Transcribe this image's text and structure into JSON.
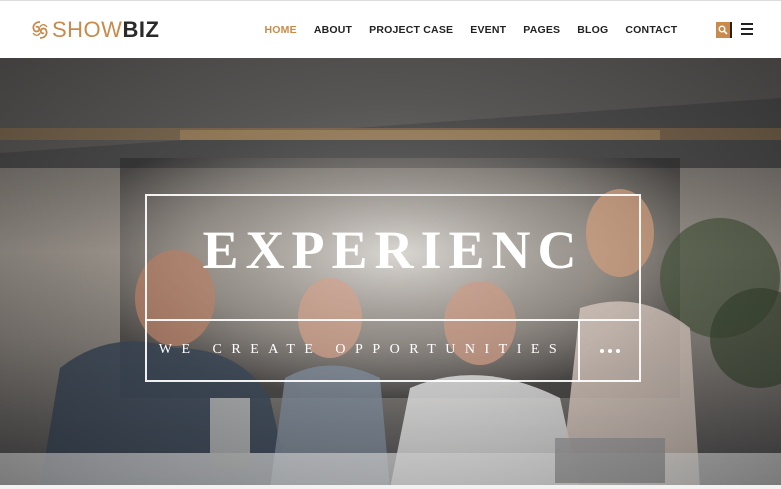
{
  "brand": {
    "name_light": "SHOW",
    "name_bold": "BIZ",
    "logo_icon": "swirl-logo-icon",
    "accent_color": "#c98a4b"
  },
  "nav": {
    "items": [
      {
        "label": "HOME",
        "active": true
      },
      {
        "label": "ABOUT",
        "active": false
      },
      {
        "label": "PROJECT CASE",
        "active": false
      },
      {
        "label": "EVENT",
        "active": false
      },
      {
        "label": "PAGES",
        "active": false
      },
      {
        "label": "BLOG",
        "active": false
      },
      {
        "label": "CONTACT",
        "active": false
      }
    ],
    "search_icon": "search-icon",
    "menu_icon": "hamburger-menu-icon"
  },
  "hero": {
    "title": "EXPERIENC",
    "subtitle": "WE CREATE OPPORTUNITIES",
    "more_icon": "ellipsis-icon"
  }
}
